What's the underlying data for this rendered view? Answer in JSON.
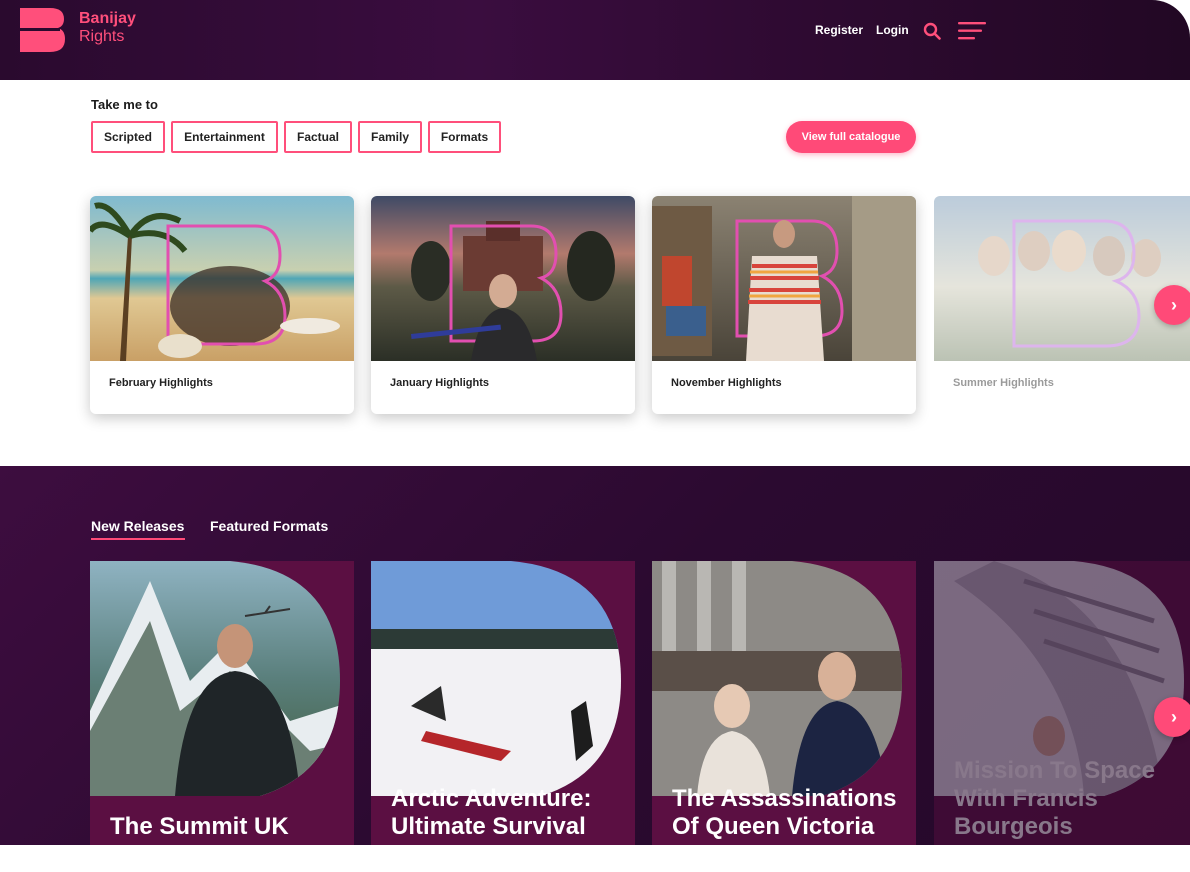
{
  "brand": {
    "line1": "Banijay",
    "line2": "Rights",
    "color": "#ff4f7b"
  },
  "nav": {
    "register": "Register",
    "login": "Login",
    "search_icon": "search-icon",
    "menu_icon": "menu-icon"
  },
  "take_me_to": {
    "title": "Take me to",
    "chips": [
      "Scripted",
      "Entertainment",
      "Factual",
      "Family",
      "Formats"
    ],
    "catalogue_button": "View full catalogue"
  },
  "highlights": [
    {
      "label": "February Highlights"
    },
    {
      "label": "January Highlights"
    },
    {
      "label": "November Highlights"
    },
    {
      "label": "Summer Highlights"
    }
  ],
  "tabs": [
    {
      "label": "New Releases",
      "active": true
    },
    {
      "label": "Featured Formats",
      "active": false
    }
  ],
  "releases": [
    {
      "title": "The Summit UK"
    },
    {
      "title": "Arctic Adventure: Ultimate Survival"
    },
    {
      "title": "The Assassinations Of Queen Victoria"
    },
    {
      "title": "Mission To Space With Francis Bourgeois"
    }
  ],
  "next_arrow": "›"
}
